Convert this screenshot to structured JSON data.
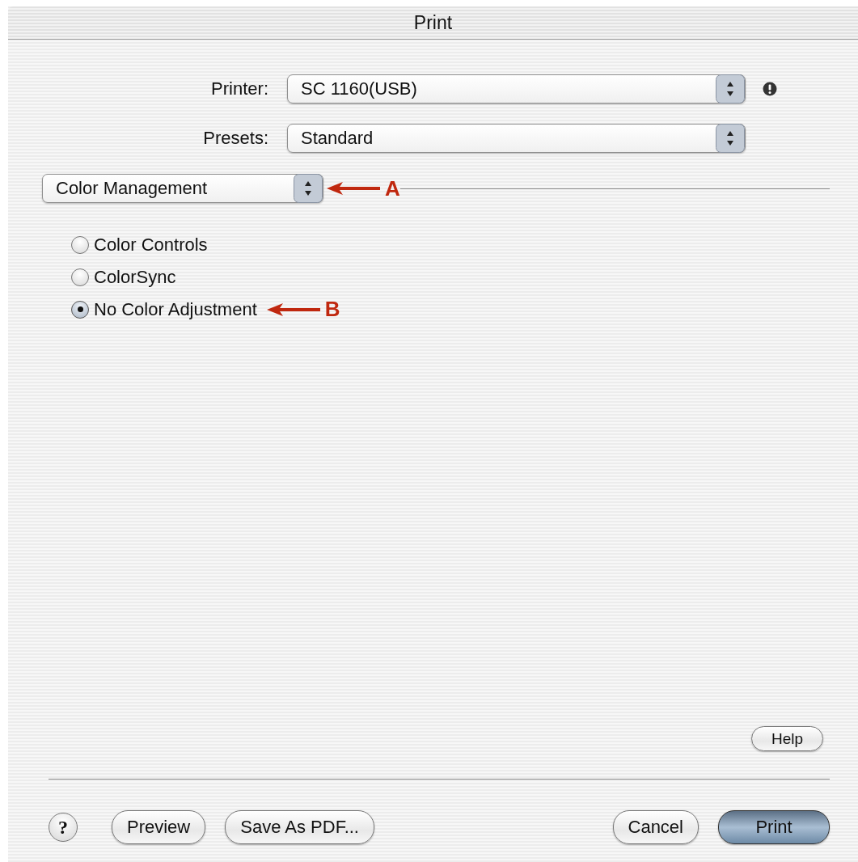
{
  "window": {
    "title": "Print"
  },
  "fields": [
    {
      "label": "Printer:",
      "value": "SC 1160(USB)",
      "warning": true
    },
    {
      "label": "Presets:",
      "value": "Standard",
      "warning": false
    }
  ],
  "panel_menu": {
    "value": "Color Management",
    "annotation": "A"
  },
  "options": [
    {
      "label": "Color Controls",
      "selected": false
    },
    {
      "label": "ColorSync",
      "selected": false
    },
    {
      "label": "No Color Adjustment",
      "selected": true,
      "annotation": "B"
    }
  ],
  "help_button": "Help",
  "help_icon": "?",
  "left_buttons": [
    {
      "label": "Preview",
      "kind": "normal"
    },
    {
      "label": "Save As PDF...",
      "kind": "normal"
    }
  ],
  "right_buttons": [
    {
      "label": "Cancel",
      "kind": "normal"
    },
    {
      "label": "Print",
      "kind": "default"
    }
  ]
}
